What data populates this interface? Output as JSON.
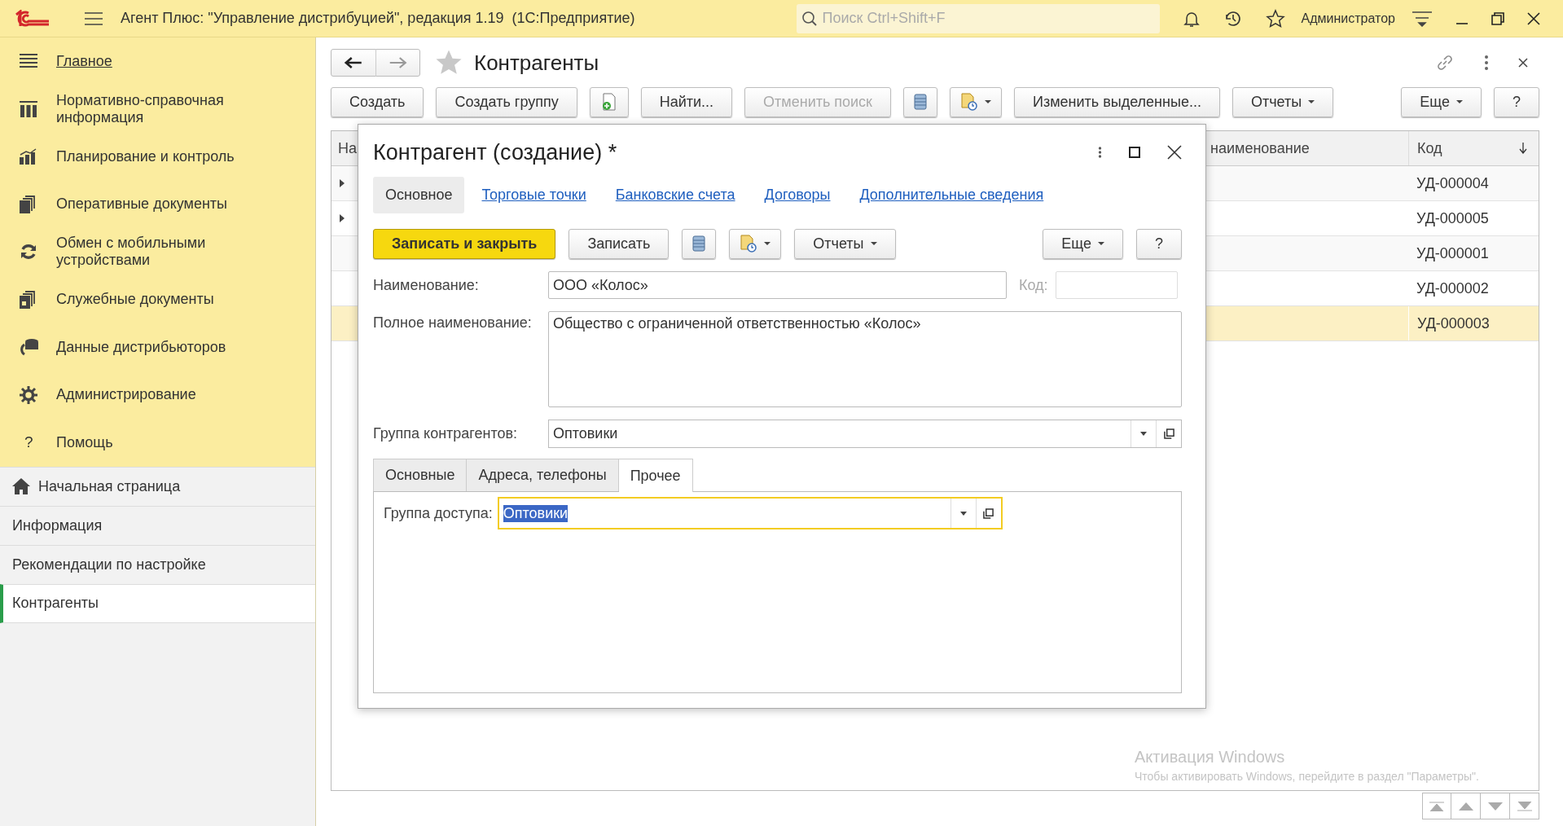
{
  "app_bar": {
    "title": "Агент Плюс: \"Управление дистрибуцией\", редакция 1.19  (1С:Предприятие)",
    "search": {
      "placeholder": "Поиск Ctrl+Shift+F"
    },
    "user": "Администратор"
  },
  "sidebar": {
    "sections": [
      {
        "label": "Главное",
        "kind": "menu",
        "selected": true
      },
      {
        "label": "Нормативно-справочная информация",
        "kind": "catalog",
        "selected": false
      },
      {
        "label": "Планирование и контроль",
        "kind": "chart",
        "selected": false
      },
      {
        "label": "Оперативные документы",
        "kind": "docs",
        "selected": false
      },
      {
        "label": "Обмен с мобильными устройствами",
        "kind": "sync",
        "selected": false
      },
      {
        "label": "Служебные документы",
        "kind": "service",
        "selected": false
      },
      {
        "label": "Данные дистрибьюторов",
        "kind": "data",
        "selected": false
      },
      {
        "label": "Администрирование",
        "kind": "gear",
        "selected": false
      },
      {
        "label": "Помощь",
        "kind": "glyph",
        "glyph": "?",
        "selected": false
      }
    ],
    "open_windows": [
      {
        "label": "Начальная страница",
        "kind": "home",
        "selected": false
      },
      {
        "label": "Информация",
        "kind": "plain",
        "selected": false
      },
      {
        "label": "Рекомендации по настройке",
        "kind": "plain",
        "selected": false
      },
      {
        "label": "Контрагенты",
        "kind": "plain",
        "selected": true
      }
    ]
  },
  "form": {
    "title": "Контрагенты",
    "toolbar": [
      {
        "kind": "text",
        "label": "Создать",
        "disabled": false,
        "dropdown": false
      },
      {
        "kind": "text",
        "label": "Создать группу",
        "disabled": false,
        "dropdown": false
      },
      {
        "kind": "add-doc",
        "disabled": false,
        "dropdown": false
      },
      {
        "kind": "text",
        "label": "Найти...",
        "disabled": false,
        "dropdown": false
      },
      {
        "kind": "text",
        "label": "Отменить поиск",
        "disabled": true,
        "dropdown": false
      },
      {
        "kind": "list",
        "disabled": false,
        "dropdown": false
      },
      {
        "kind": "attach",
        "disabled": false,
        "dropdown": true
      },
      {
        "kind": "text",
        "label": "Изменить выделенные...",
        "disabled": false,
        "dropdown": false
      },
      {
        "kind": "text",
        "label": "Отчеты",
        "disabled": false,
        "dropdown": true
      },
      {
        "kind": "spacer"
      },
      {
        "kind": "text",
        "label": "Еще",
        "disabled": false,
        "dropdown": true
      },
      {
        "kind": "text",
        "label": "?",
        "disabled": false,
        "dropdown": false
      }
    ],
    "table": {
      "columns": [
        {
          "label": "На"
        },
        {
          "label": "наименование"
        },
        {
          "label": "Код",
          "sorted": true
        }
      ],
      "rows": [
        {
          "expandable": true,
          "code": "УД-000004",
          "selected": false
        },
        {
          "expandable": true,
          "code": "УД-000005",
          "selected": false
        },
        {
          "expandable": false,
          "code": "УД-000001",
          "selected": false
        },
        {
          "expandable": false,
          "code": "УД-000002",
          "selected": false
        },
        {
          "expandable": false,
          "code": "УД-000003",
          "selected": true
        }
      ]
    }
  },
  "dialog": {
    "title": "Контрагент (создание) *",
    "tabs": [
      {
        "label": "Основное",
        "selected": true
      },
      {
        "label": "Торговые точки",
        "selected": false
      },
      {
        "label": "Банковские счета",
        "selected": false
      },
      {
        "label": "Договоры",
        "selected": false
      },
      {
        "label": "Дополнительные сведения",
        "selected": false
      }
    ],
    "toolbar": [
      {
        "kind": "text",
        "label": "Записать и закрыть",
        "primary": true,
        "dropdown": false
      },
      {
        "kind": "text",
        "label": "Записать",
        "primary": false,
        "dropdown": false
      },
      {
        "kind": "list",
        "primary": false,
        "dropdown": false
      },
      {
        "kind": "attach",
        "primary": false,
        "dropdown": true
      },
      {
        "kind": "text",
        "label": "Отчеты",
        "primary": false,
        "dropdown": true
      },
      {
        "kind": "spacer"
      },
      {
        "kind": "text",
        "label": "Еще",
        "primary": false,
        "dropdown": true
      },
      {
        "kind": "text",
        "label": "?",
        "primary": false,
        "dropdown": false
      }
    ],
    "name": {
      "label": "Наименование:",
      "value": "ООО «Колос»"
    },
    "code": {
      "label": "Код:",
      "disabled": true
    },
    "full_name": {
      "label": "Полное наименование:",
      "value": "Общество с ограниченной ответственностью «Колос»"
    },
    "group": {
      "label": "Группа контрагентов:",
      "value": "Оптовики"
    },
    "subtabs": [
      {
        "label": "Основные",
        "selected": false
      },
      {
        "label": "Адреса, телефоны",
        "selected": false
      },
      {
        "label": "Прочее",
        "selected": true
      }
    ],
    "access_group": {
      "label": "Группа доступа:",
      "value": "Оптовики",
      "focused": true,
      "text_selected": true
    }
  },
  "windows_notice": {
    "title": "Активация Windows",
    "text": "Чтобы активировать Windows, перейдите в раздел \"Параметры\"."
  }
}
